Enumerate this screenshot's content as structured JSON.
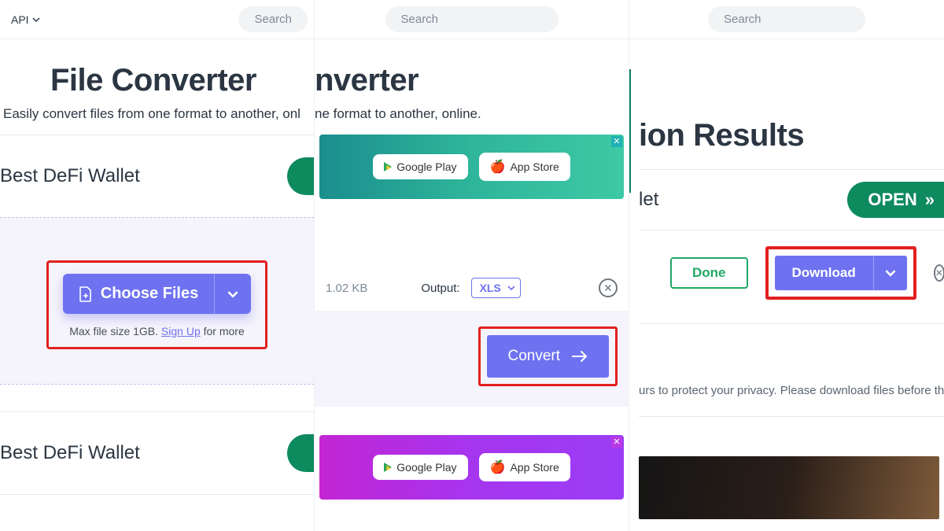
{
  "panel1": {
    "api_label": "API",
    "search_placeholder": "Search",
    "title": "File Converter",
    "subtitle": "Easily convert files from one format to another, onl",
    "ad_text": "Best DeFi Wallet",
    "choose_files_label": "Choose Files",
    "hint_prefix": "Max file size 1GB. ",
    "hint_link": "Sign Up",
    "hint_suffix": " for more",
    "ad_text_2": "Best DeFi Wallet"
  },
  "panel2": {
    "search_placeholder": "Search",
    "title_fragment": "nverter",
    "subtitle_fragment": "ne format to another, online.",
    "google_play": "Google Play",
    "app_store": "App Store",
    "file_size": "1.02 KB",
    "output_label": "Output:",
    "output_format": "XLS",
    "convert_label": "Convert"
  },
  "panel3": {
    "search_placeholder": "Search",
    "title_fragment": "ion Results",
    "let_fragment": "let",
    "open_label": "OPEN",
    "done_label": "Done",
    "download_label": "Download",
    "privacy_text": "urs to protect your privacy. Please download files before they"
  }
}
